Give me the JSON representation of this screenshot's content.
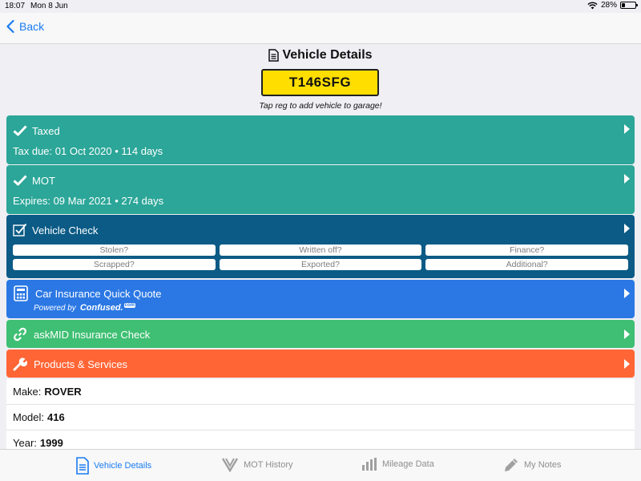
{
  "status": {
    "time": "18:07",
    "date": "Mon 8 Jun",
    "battery": "28%",
    "battery_level": 0.28
  },
  "nav": {
    "back_label": "Back"
  },
  "header": {
    "title": "Vehicle Details",
    "reg": "T146SFG",
    "hint": "Tap reg to add vehicle to garage!"
  },
  "taxed": {
    "title": "Taxed",
    "due_label": "Tax due: 01 Oct 2020",
    "days": "• 114 days",
    "color": "#2ba698"
  },
  "mot": {
    "title": "MOT",
    "expires_label": "Expires: 09 Mar 2021",
    "days": "• 274 days",
    "color": "#2ba698"
  },
  "check": {
    "title": "Vehicle Check",
    "color": "#0b5b86",
    "options": [
      "Stolen?",
      "Written off?",
      "Finance?",
      "Scrapped?",
      "Exported?",
      "Additional?"
    ]
  },
  "insurance": {
    "title": "Car Insurance Quick Quote",
    "powered_by": "Powered by",
    "brand": "Confused",
    "color": "#2b78e4"
  },
  "askmid": {
    "title": "askMID Insurance Check",
    "color": "#3fbf73"
  },
  "products": {
    "title": "Products & Services",
    "color": "#ff6535"
  },
  "details": [
    {
      "label": "Make:",
      "value": "ROVER"
    },
    {
      "label": "Model:",
      "value": "416"
    },
    {
      "label": "Year:",
      "value": "1999"
    }
  ],
  "tabs": [
    {
      "label": "Vehicle Details",
      "icon": "document-icon",
      "active": true
    },
    {
      "label": "MOT History",
      "icon": "mot-icon",
      "active": false
    },
    {
      "label": "Mileage Data",
      "icon": "bar-chart-icon",
      "active": false
    },
    {
      "label": "My Notes",
      "icon": "pencil-icon",
      "active": false
    }
  ]
}
